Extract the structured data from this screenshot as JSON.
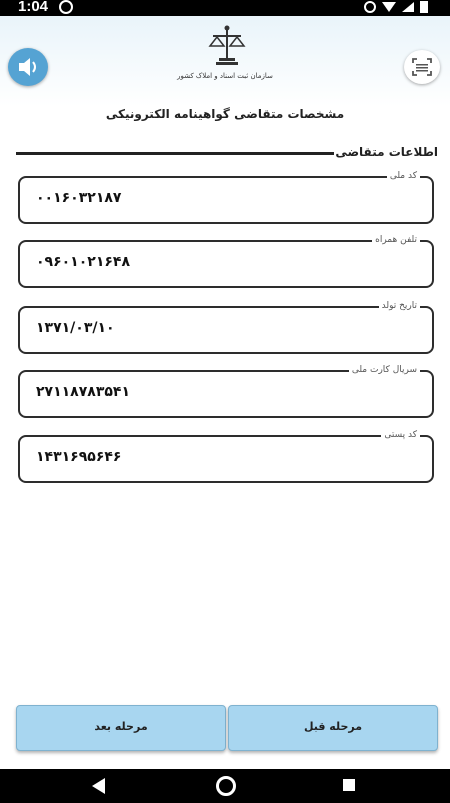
{
  "status_bar": {
    "time": "1:04"
  },
  "header": {
    "org_name": "سازمان ثبت اسناد و املاک کشور",
    "page_title": "مشخصات متقاضی گواهینامه الکترونیکی",
    "speaker_icon": "speaker-icon",
    "scan_icon": "scan-icon",
    "emblem_icon": "justice-scales-emblem"
  },
  "section": {
    "title": "اطلاعات متقاضی"
  },
  "fields": [
    {
      "label": "کد ملی",
      "value": "۰۰۱۶۰۳۲۱۸۷"
    },
    {
      "label": "تلفن همراه",
      "value": "۰۹۶۰۱۰۲۱۶۴۸"
    },
    {
      "label": "تاریخ تولد",
      "value": "۱۳۷۱/۰۳/۱۰"
    },
    {
      "label": "سریال کارت ملی",
      "value": "۲۷۱۱۸۷۸۳۵۴۱"
    },
    {
      "label": "کد پستی",
      "value": "۱۴۳۱۶۹۵۶۴۶"
    }
  ],
  "buttons": {
    "next": "مرحله بعد",
    "prev": "مرحله قبل"
  },
  "colors": {
    "accent": "#55a3d3",
    "button": "#a8d6f0"
  }
}
